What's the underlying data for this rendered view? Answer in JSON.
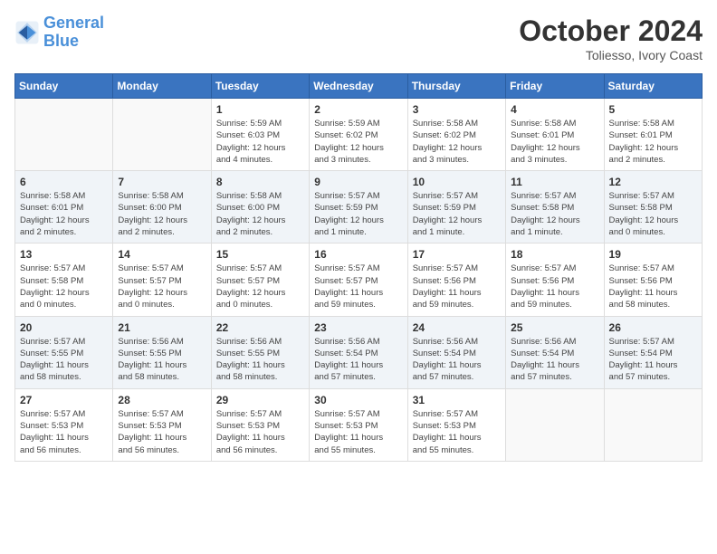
{
  "logo": {
    "line1": "General",
    "line2": "Blue"
  },
  "title": "October 2024",
  "subtitle": "Toliesso, Ivory Coast",
  "days_header": [
    "Sunday",
    "Monday",
    "Tuesday",
    "Wednesday",
    "Thursday",
    "Friday",
    "Saturday"
  ],
  "weeks": [
    [
      {
        "day": "",
        "info": ""
      },
      {
        "day": "",
        "info": ""
      },
      {
        "day": "1",
        "info": "Sunrise: 5:59 AM\nSunset: 6:03 PM\nDaylight: 12 hours\nand 4 minutes."
      },
      {
        "day": "2",
        "info": "Sunrise: 5:59 AM\nSunset: 6:02 PM\nDaylight: 12 hours\nand 3 minutes."
      },
      {
        "day": "3",
        "info": "Sunrise: 5:58 AM\nSunset: 6:02 PM\nDaylight: 12 hours\nand 3 minutes."
      },
      {
        "day": "4",
        "info": "Sunrise: 5:58 AM\nSunset: 6:01 PM\nDaylight: 12 hours\nand 3 minutes."
      },
      {
        "day": "5",
        "info": "Sunrise: 5:58 AM\nSunset: 6:01 PM\nDaylight: 12 hours\nand 2 minutes."
      }
    ],
    [
      {
        "day": "6",
        "info": "Sunrise: 5:58 AM\nSunset: 6:01 PM\nDaylight: 12 hours\nand 2 minutes."
      },
      {
        "day": "7",
        "info": "Sunrise: 5:58 AM\nSunset: 6:00 PM\nDaylight: 12 hours\nand 2 minutes."
      },
      {
        "day": "8",
        "info": "Sunrise: 5:58 AM\nSunset: 6:00 PM\nDaylight: 12 hours\nand 2 minutes."
      },
      {
        "day": "9",
        "info": "Sunrise: 5:57 AM\nSunset: 5:59 PM\nDaylight: 12 hours\nand 1 minute."
      },
      {
        "day": "10",
        "info": "Sunrise: 5:57 AM\nSunset: 5:59 PM\nDaylight: 12 hours\nand 1 minute."
      },
      {
        "day": "11",
        "info": "Sunrise: 5:57 AM\nSunset: 5:58 PM\nDaylight: 12 hours\nand 1 minute."
      },
      {
        "day": "12",
        "info": "Sunrise: 5:57 AM\nSunset: 5:58 PM\nDaylight: 12 hours\nand 0 minutes."
      }
    ],
    [
      {
        "day": "13",
        "info": "Sunrise: 5:57 AM\nSunset: 5:58 PM\nDaylight: 12 hours\nand 0 minutes."
      },
      {
        "day": "14",
        "info": "Sunrise: 5:57 AM\nSunset: 5:57 PM\nDaylight: 12 hours\nand 0 minutes."
      },
      {
        "day": "15",
        "info": "Sunrise: 5:57 AM\nSunset: 5:57 PM\nDaylight: 12 hours\nand 0 minutes."
      },
      {
        "day": "16",
        "info": "Sunrise: 5:57 AM\nSunset: 5:57 PM\nDaylight: 11 hours\nand 59 minutes."
      },
      {
        "day": "17",
        "info": "Sunrise: 5:57 AM\nSunset: 5:56 PM\nDaylight: 11 hours\nand 59 minutes."
      },
      {
        "day": "18",
        "info": "Sunrise: 5:57 AM\nSunset: 5:56 PM\nDaylight: 11 hours\nand 59 minutes."
      },
      {
        "day": "19",
        "info": "Sunrise: 5:57 AM\nSunset: 5:56 PM\nDaylight: 11 hours\nand 58 minutes."
      }
    ],
    [
      {
        "day": "20",
        "info": "Sunrise: 5:57 AM\nSunset: 5:55 PM\nDaylight: 11 hours\nand 58 minutes."
      },
      {
        "day": "21",
        "info": "Sunrise: 5:56 AM\nSunset: 5:55 PM\nDaylight: 11 hours\nand 58 minutes."
      },
      {
        "day": "22",
        "info": "Sunrise: 5:56 AM\nSunset: 5:55 PM\nDaylight: 11 hours\nand 58 minutes."
      },
      {
        "day": "23",
        "info": "Sunrise: 5:56 AM\nSunset: 5:54 PM\nDaylight: 11 hours\nand 57 minutes."
      },
      {
        "day": "24",
        "info": "Sunrise: 5:56 AM\nSunset: 5:54 PM\nDaylight: 11 hours\nand 57 minutes."
      },
      {
        "day": "25",
        "info": "Sunrise: 5:56 AM\nSunset: 5:54 PM\nDaylight: 11 hours\nand 57 minutes."
      },
      {
        "day": "26",
        "info": "Sunrise: 5:57 AM\nSunset: 5:54 PM\nDaylight: 11 hours\nand 57 minutes."
      }
    ],
    [
      {
        "day": "27",
        "info": "Sunrise: 5:57 AM\nSunset: 5:53 PM\nDaylight: 11 hours\nand 56 minutes."
      },
      {
        "day": "28",
        "info": "Sunrise: 5:57 AM\nSunset: 5:53 PM\nDaylight: 11 hours\nand 56 minutes."
      },
      {
        "day": "29",
        "info": "Sunrise: 5:57 AM\nSunset: 5:53 PM\nDaylight: 11 hours\nand 56 minutes."
      },
      {
        "day": "30",
        "info": "Sunrise: 5:57 AM\nSunset: 5:53 PM\nDaylight: 11 hours\nand 55 minutes."
      },
      {
        "day": "31",
        "info": "Sunrise: 5:57 AM\nSunset: 5:53 PM\nDaylight: 11 hours\nand 55 minutes."
      },
      {
        "day": "",
        "info": ""
      },
      {
        "day": "",
        "info": ""
      }
    ]
  ]
}
